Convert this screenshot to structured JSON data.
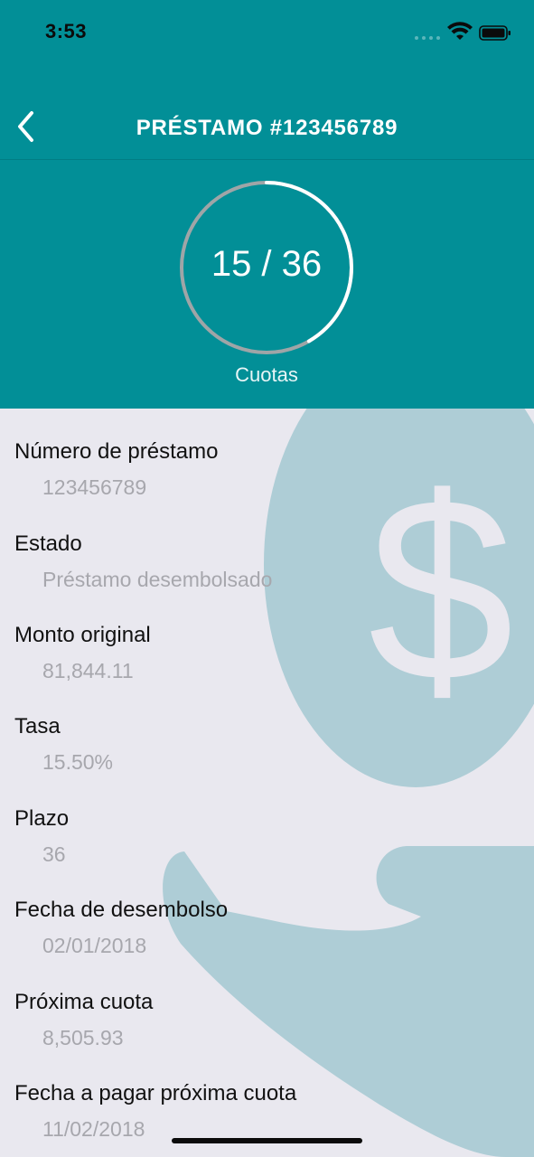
{
  "status_bar": {
    "time": "3:53"
  },
  "header": {
    "title": "PRÉSTAMO #123456789",
    "background_color": "#028f97"
  },
  "progress": {
    "paid": 15,
    "total": 36,
    "display": "15 / 36",
    "caption": "Cuotas"
  },
  "details": [
    {
      "label": "Número de préstamo",
      "value": "123456789"
    },
    {
      "label": "Estado",
      "value": "Préstamo desembolsado"
    },
    {
      "label": "Monto original",
      "value": "81,844.11"
    },
    {
      "label": "Tasa",
      "value": "15.50%"
    },
    {
      "label": "Plazo",
      "value": "36"
    },
    {
      "label": "Fecha de desembolso",
      "value": "02/01/2018"
    },
    {
      "label": "Próxima cuota",
      "value": "8,505.93"
    },
    {
      "label": "Fecha a pagar próxima cuota",
      "value": "11/02/2018"
    }
  ],
  "icons": {
    "back": "chevron-left-icon",
    "background": "hand-with-coin-dollar-icon"
  }
}
